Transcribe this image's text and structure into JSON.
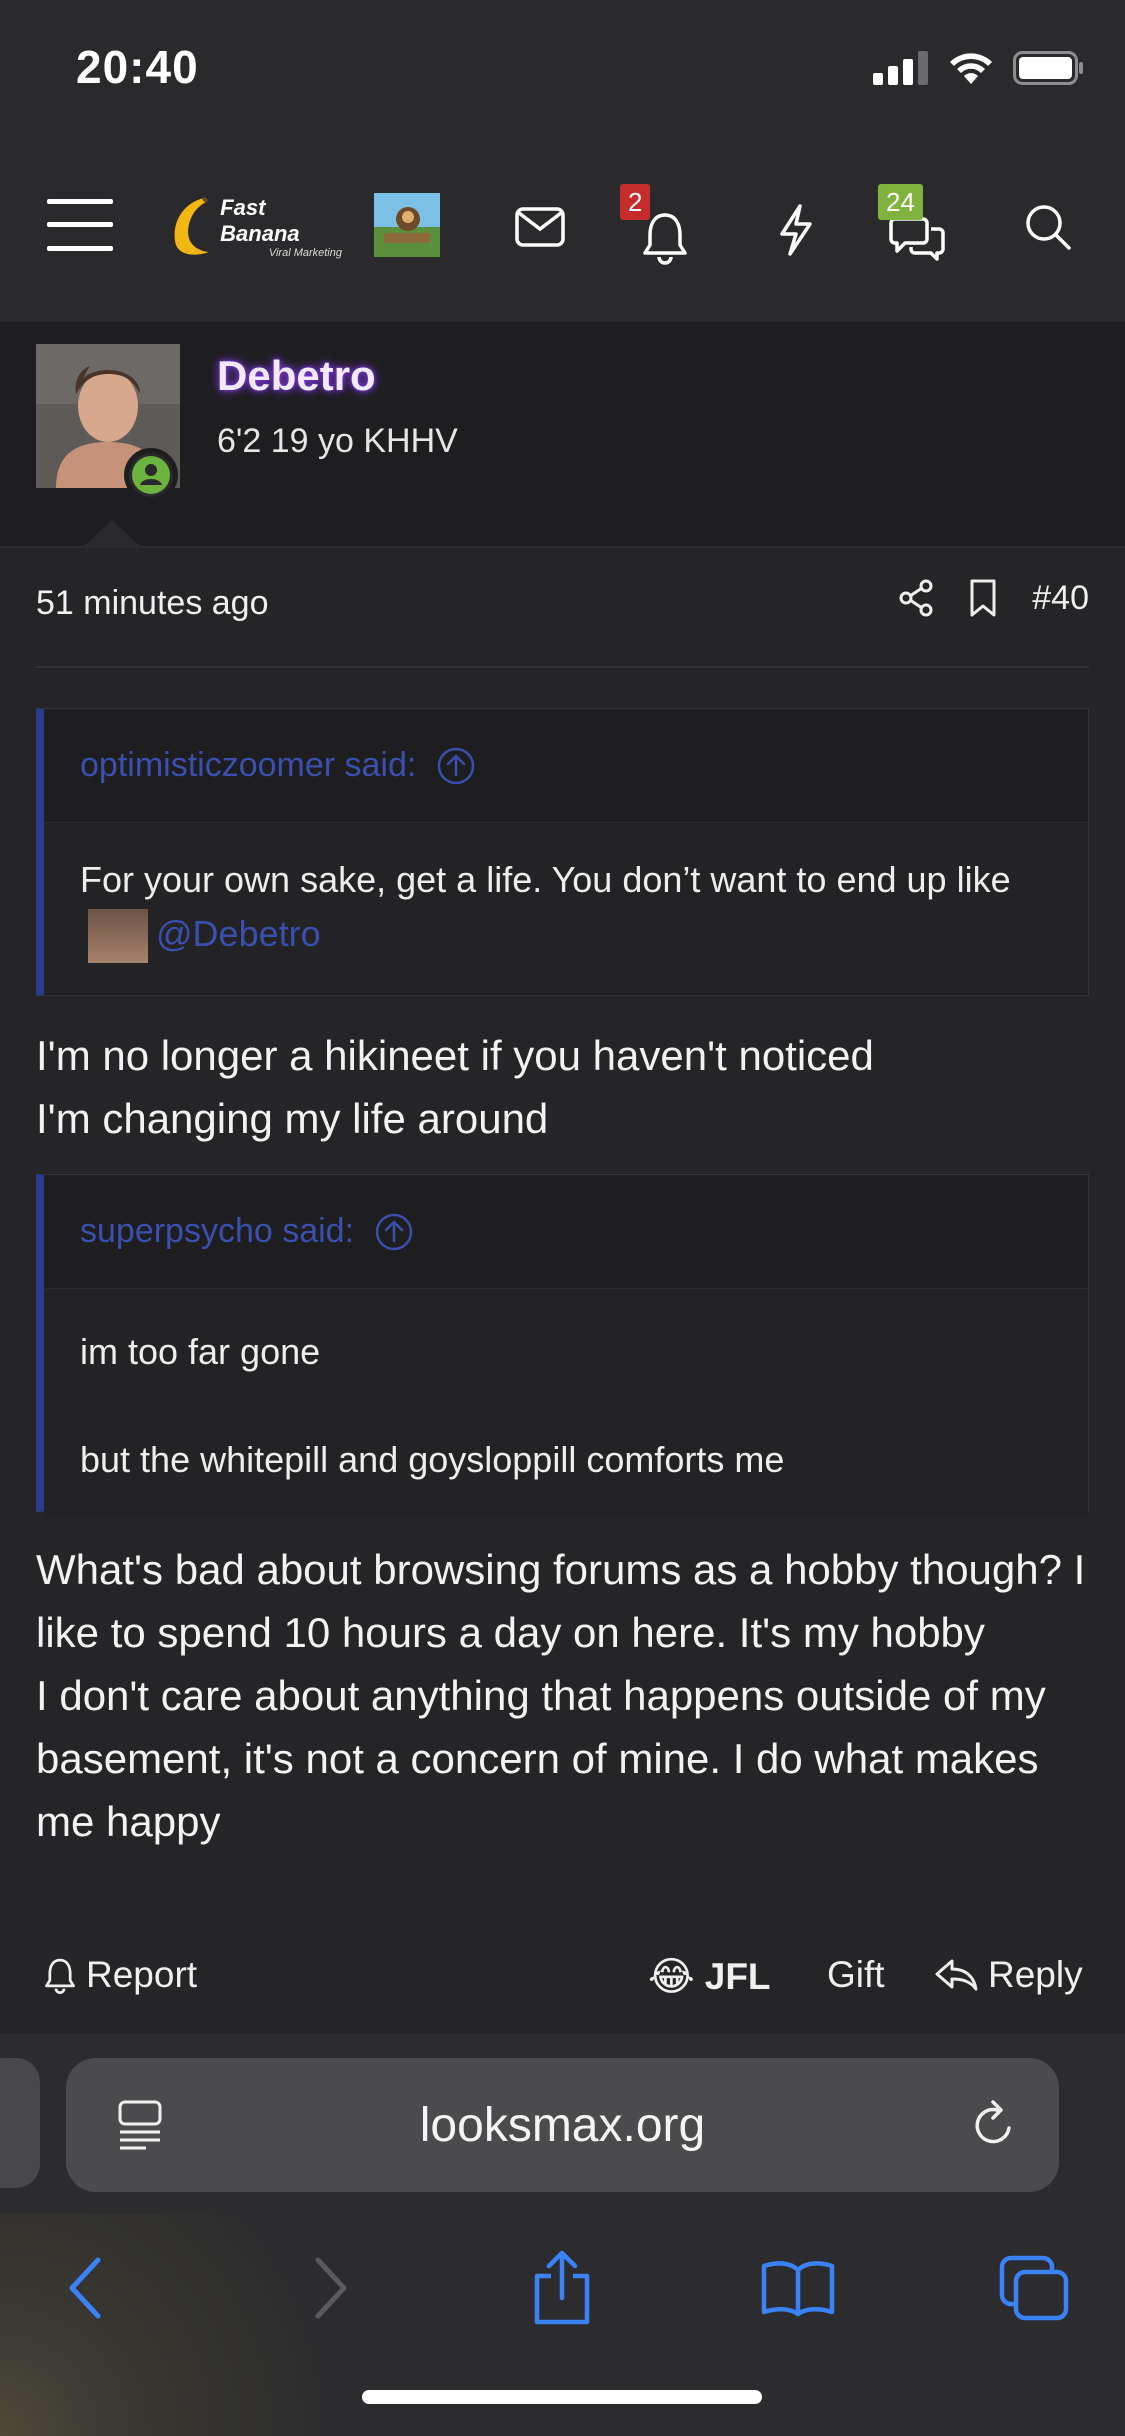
{
  "status_bar": {
    "time": "20:40"
  },
  "forum_nav": {
    "logo_text": "Fast Banana",
    "logo_subtext": "Viral Marketing",
    "notifications_count": "2",
    "conversations_count": "24"
  },
  "post": {
    "author": "Debetro",
    "user_title": "6'2 19 yo KHHV",
    "time": "51 minutes ago",
    "post_number": "#40",
    "quotes": [
      {
        "author_line": "optimisticzoomer said:",
        "text_before": "For your own sake, get a life. You don’t want to end up like",
        "mention": "@Debetro"
      },
      {
        "author_line": "superpsycho said:",
        "paragraphs": [
          "im too far gone",
          "but the whitepill and goysloppill comforts me"
        ]
      }
    ],
    "body_1": [
      "I'm no longer a hikineet if you haven't noticed",
      "I'm changing my life around"
    ],
    "body_2": [
      "What's bad about browsing forums as a hobby though? I like to spend 10 hours a day on here. It's my hobby",
      "I don't care about anything that happens outside of my basement, it's not a concern of mine. I do what makes me happy"
    ],
    "actions": {
      "report": "Report",
      "reaction_emoji": "😂",
      "reaction": "JFL",
      "gift": "Gift",
      "reply": "Reply"
    }
  },
  "browser": {
    "url": "looksmax.org",
    "accent_color": "#3b82f6"
  }
}
